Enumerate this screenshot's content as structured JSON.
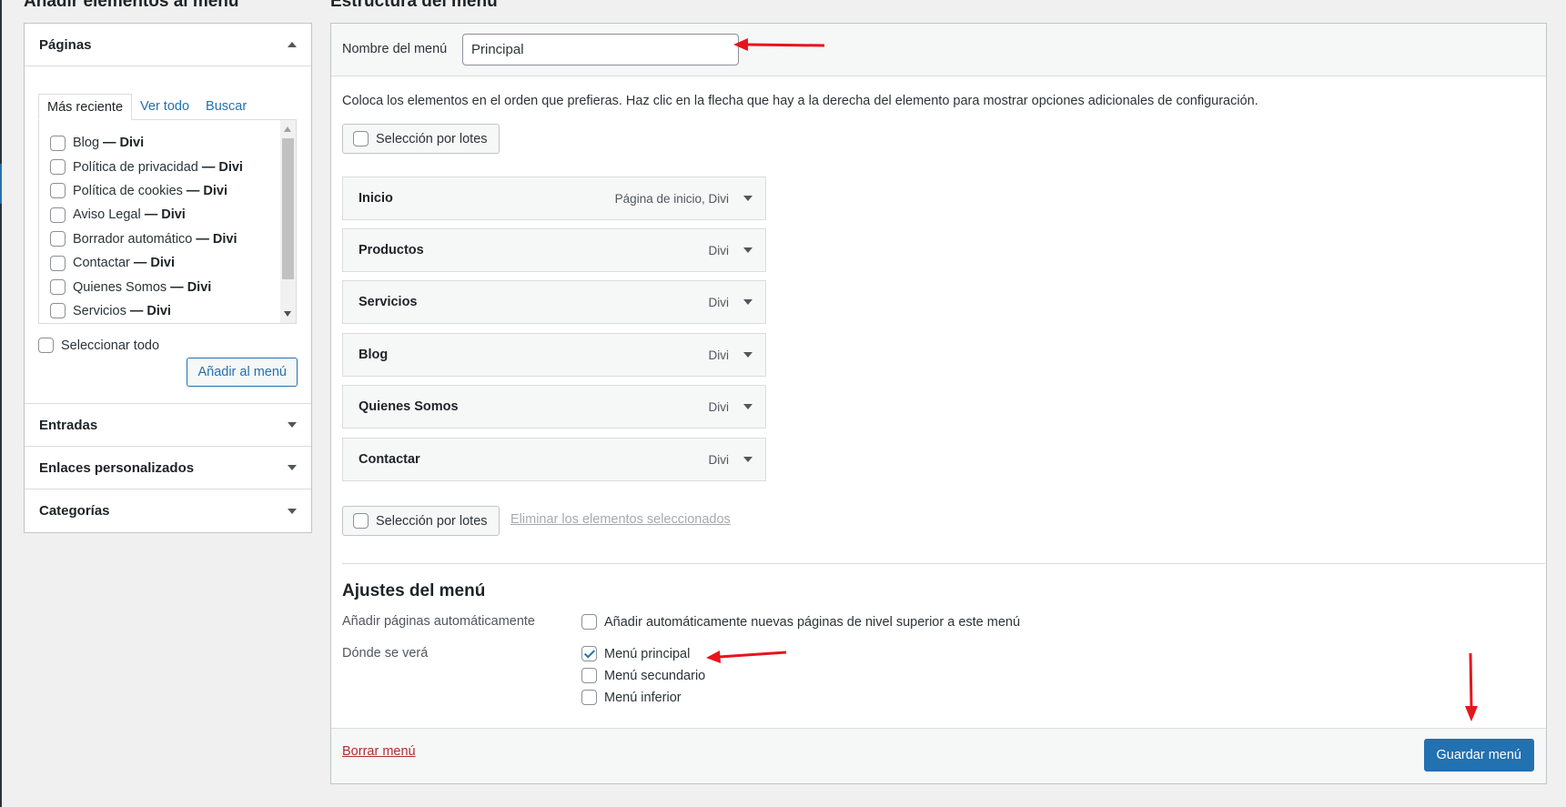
{
  "left_heading": "Añadir elementos al menú",
  "right_heading": "Estructura del menú",
  "pages_section": {
    "title": "Páginas",
    "tabs": [
      {
        "label": "Más reciente",
        "active": true
      },
      {
        "label": "Ver todo",
        "active": false
      },
      {
        "label": "Buscar",
        "active": false
      }
    ],
    "items": [
      {
        "name": "Blog",
        "theme": "— Divi"
      },
      {
        "name": "Política de privacidad",
        "theme": "— Divi"
      },
      {
        "name": "Política de cookies",
        "theme": "— Divi"
      },
      {
        "name": "Aviso Legal",
        "theme": "— Divi"
      },
      {
        "name": "Borrador automático",
        "theme": "— Divi"
      },
      {
        "name": "Contactar",
        "theme": "— Divi"
      },
      {
        "name": "Quienes Somos",
        "theme": "— Divi"
      },
      {
        "name": "Servicios",
        "theme": "— Divi"
      }
    ],
    "select_all_label": "Seleccionar todo",
    "add_button_label": "Añadir al menú"
  },
  "other_sections": [
    {
      "title": "Entradas"
    },
    {
      "title": "Enlaces personalizados"
    },
    {
      "title": "Categorías"
    }
  ],
  "menu_structure": {
    "name_label": "Nombre del menú",
    "name_value": "Principal",
    "instructions": "Coloca los elementos en el orden que prefieras. Haz clic en la flecha que hay a la derecha del elemento para mostrar opciones adicionales de configuración.",
    "bulk_select_label": "Selección por lotes",
    "items": [
      {
        "title": "Inicio",
        "type": "Página de inicio, Divi"
      },
      {
        "title": "Productos",
        "type": "Divi"
      },
      {
        "title": "Servicios",
        "type": "Divi"
      },
      {
        "title": "Blog",
        "type": "Divi"
      },
      {
        "title": "Quienes Somos",
        "type": "Divi"
      },
      {
        "title": "Contactar",
        "type": "Divi"
      }
    ],
    "delete_selected_label": "Eliminar los elementos seleccionados"
  },
  "menu_settings": {
    "title": "Ajustes del menú",
    "auto_add_label": "Añadir páginas automáticamente",
    "auto_add_option": "Añadir automáticamente nuevas páginas de nivel superior a este menú",
    "auto_add_checked": false,
    "location_label": "Dónde se verá",
    "locations": [
      {
        "label": "Menú principal",
        "checked": true
      },
      {
        "label": "Menú secundario",
        "checked": false
      },
      {
        "label": "Menú inferior",
        "checked": false
      }
    ]
  },
  "footer": {
    "delete_menu_label": "Borrar menú",
    "save_button_label": "Guardar menú"
  },
  "colors": {
    "primary": "#2271b1",
    "danger": "#b32d2e",
    "annotation": "#e8141c"
  }
}
